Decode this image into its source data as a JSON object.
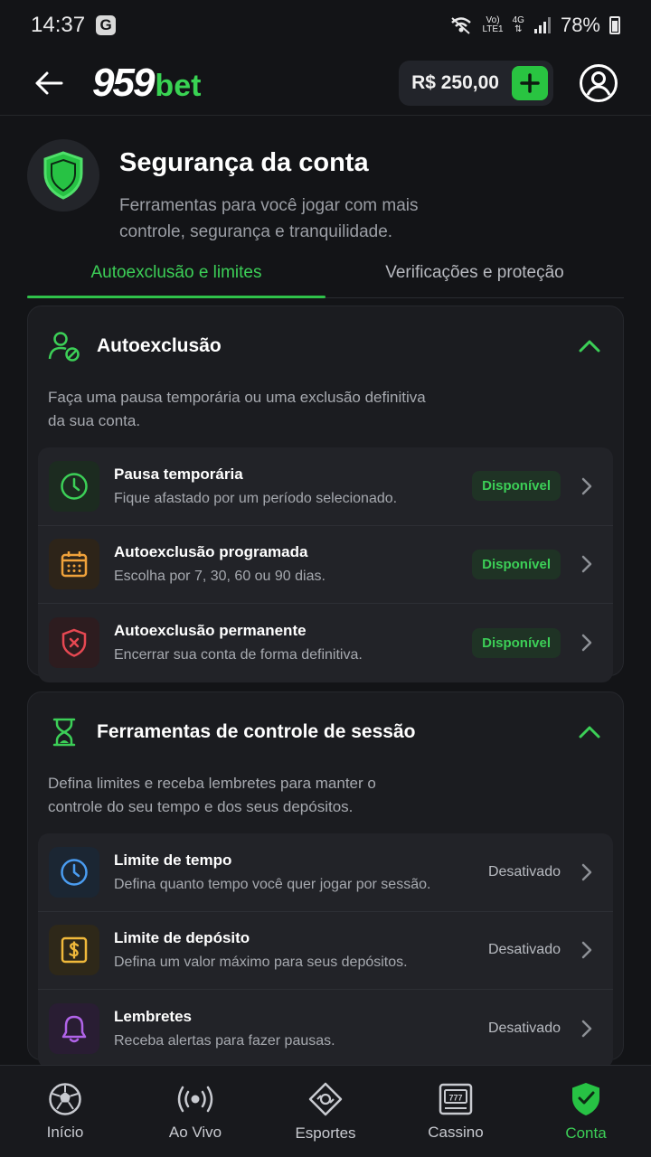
{
  "status_bar": {
    "time": "14:37",
    "g_icon": "G",
    "net_top": "Vo)",
    "net_bottom": "LTE1",
    "net_4g": "4G",
    "battery": "78%"
  },
  "header": {
    "logo_number": "959",
    "logo_suffix": "bet",
    "balance": "R$ 250,00"
  },
  "hero": {
    "title": "Segurança da conta",
    "subtitle": "Ferramentas para você jogar com mais controle, segurança e tranquilidade."
  },
  "tabs": [
    {
      "label": "Autoexclusão e limites",
      "active": true
    },
    {
      "label": "Verificações e proteção",
      "active": false
    }
  ],
  "autoexclusion": {
    "title": "Autoexclusão",
    "description": "Faça uma pausa temporária ou uma exclusão definitiva da sua conta.",
    "items": [
      {
        "title": "Pausa temporária",
        "subtitle": "Fique afastado por um período selecionado.",
        "status": "Disponível",
        "icon": "clock-icon",
        "color": "#3ccf57"
      },
      {
        "title": "Autoexclusão programada",
        "subtitle": "Escolha por 7, 30, 60 ou 90 dias.",
        "status": "Disponível",
        "icon": "calendar-icon",
        "color": "#f0a23b"
      },
      {
        "title": "Autoexclusão permanente",
        "subtitle": "Encerrar sua conta de forma definitiva.",
        "status": "Disponível",
        "icon": "shield-x-icon",
        "color": "#e64852"
      }
    ]
  },
  "session_tools": {
    "title": "Ferramentas de controle de sessão",
    "description": "Defina limites e receba lembretes para manter o controle do seu tempo e dos seus depósitos.",
    "items": [
      {
        "title": "Limite de tempo",
        "subtitle": "Defina quanto tempo você quer jogar por sessão.",
        "status": "Desativado",
        "icon": "clock-icon",
        "color": "#4a9cf0"
      },
      {
        "title": "Limite de depósito",
        "subtitle": "Defina um valor máximo para seus depósitos.",
        "status": "Desativado",
        "icon": "dollar-icon",
        "color": "#f0b93b"
      },
      {
        "title": "Lembretes",
        "subtitle": "Receba alertas para fazer pausas.",
        "status": "Desativado",
        "icon": "bell-icon",
        "color": "#b063e8"
      }
    ]
  },
  "bottom_nav": [
    {
      "label": "Início",
      "icon": "soccer-ball-icon"
    },
    {
      "label": "Ao Vivo",
      "icon": "live-icon"
    },
    {
      "label": "Esportes",
      "icon": "ticket-icon"
    },
    {
      "label": "Cassino",
      "icon": "slot-machine-icon"
    },
    {
      "label": "Conta",
      "icon": "shield-check-icon",
      "active": true
    }
  ],
  "colors": {
    "accent": "#3ccf57",
    "background": "#131417",
    "card": "#1b1c20"
  }
}
